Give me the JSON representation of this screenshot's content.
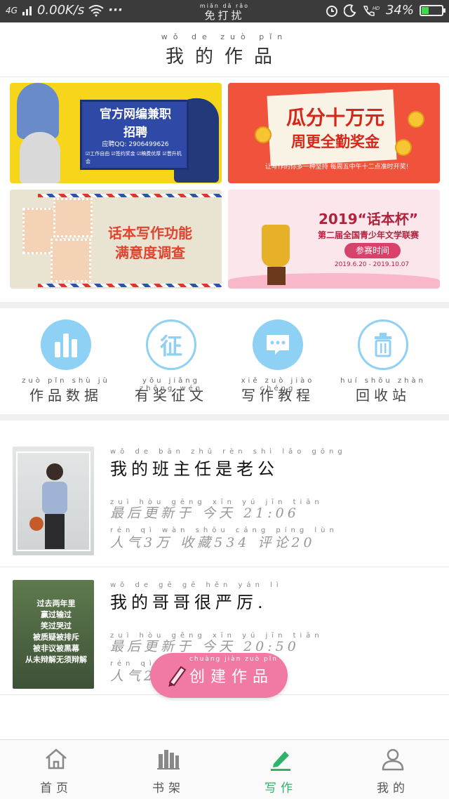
{
  "status_bar": {
    "network": "4G",
    "speed": "0.00K/s",
    "dots": "···",
    "center_pinyin": "miǎn  dǎ  rǎo",
    "center_text": "免打扰",
    "battery_percent": "34%",
    "battery_level": 0.34
  },
  "header": {
    "pinyin": "wǒ   de   zuò   pǐn",
    "title": "我的作品"
  },
  "banners": {
    "b1": {
      "title1": "官方网编兼职",
      "title2": "招聘",
      "contact": "应聘QQ: 2906499626",
      "tags": "☑工作自由  ☑签约奖金  ☑稿费优厚  ☑晋升机会"
    },
    "b2": {
      "title1": "瓜分十万元",
      "title2": "周更全勤奖金",
      "note": "让写作的你多一种坚持  每周五中午十二点准时开奖!"
    },
    "b3": {
      "title1": "话本写作功能",
      "title2": "满意度调查"
    },
    "b4": {
      "title1": "2019“话本杯”",
      "title2": "第二届全国青少年文学联赛",
      "pill": "参赛时间",
      "dates": "2019.6.20 - 2019.10.07"
    }
  },
  "tools": [
    {
      "pinyin": "zuò pǐn shù jù",
      "label": "作品数据",
      "color": "#8fd0f5",
      "icon": "bar-chart-icon"
    },
    {
      "pinyin": "yǒu jiǎng zhēng wén",
      "label": "有奖征文",
      "color": "#8fd0f5",
      "icon": "zheng-icon",
      "glyph": "征"
    },
    {
      "pinyin": "xiě zuò jiào chéng",
      "label": "写作教程",
      "color": "#8fd0f5",
      "icon": "chat-bubble-icon"
    },
    {
      "pinyin": "huí shōu zhàn",
      "label": "回收站",
      "color": "#8fd0f5",
      "icon": "trash-icon"
    }
  ],
  "works": [
    {
      "title_pinyin": "wǒ  de  bān  zhǔ  rèn  shì  lǎo  gōng",
      "title": "我的班主任是老公",
      "updated_pinyin": "zuì hòu gēng xīn yú   jīn tiān",
      "updated": "最后更新于 今天 21:06",
      "stats_pinyin": "rén qì   wàn   shōu cáng   píng lùn",
      "stats": "人气3万 收藏534 评论20"
    },
    {
      "title_pinyin": "wǒ  de  gē  gē  hěn  yán  lì",
      "title": "我的哥哥很严厉.",
      "updated_pinyin": "zuì hòu gēng xīn yú   jīn tiān",
      "updated": "最后更新于 今天 20:50",
      "stats_pinyin": "rén qì",
      "stats": "人气2"
    }
  ],
  "thumb2_text": [
    "过去两年里",
    "赢过输过",
    "笑过哭过",
    "被质疑被排斥",
    "被非议被黑幕",
    "从未辩解无须辩解"
  ],
  "create_button": {
    "pinyin": "chuàng jiàn zuò pǐn",
    "label": "创建作品"
  },
  "tabs": [
    {
      "pinyin": "shǒu yè",
      "label": "首页",
      "icon": "home-icon"
    },
    {
      "pinyin": "shū jià",
      "label": "书架",
      "icon": "bookshelf-icon"
    },
    {
      "pinyin": "xiě zuò",
      "label": "写作",
      "icon": "pen-icon",
      "active": true
    },
    {
      "pinyin": "wǒ de",
      "label": "我的",
      "icon": "person-icon"
    }
  ],
  "colors": {
    "accent_green": "#2db36b",
    "create_pink": "#f07aa4",
    "tool_blue": "#8fd0f5"
  }
}
